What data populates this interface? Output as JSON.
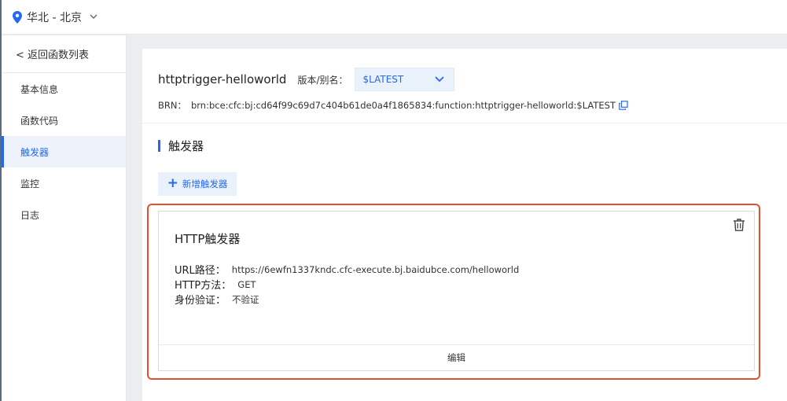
{
  "topbar": {
    "region_label": "华北 - 北京",
    "icons": {
      "pin": "location-pin-icon",
      "dropdown": "chevron-down-icon"
    }
  },
  "sidebar": {
    "back_label": "< 返回函数列表",
    "items": [
      {
        "label": "基本信息",
        "active": false
      },
      {
        "label": "函数代码",
        "active": false
      },
      {
        "label": "触发器",
        "active": true
      },
      {
        "label": "监控",
        "active": false
      },
      {
        "label": "日志",
        "active": false
      }
    ]
  },
  "main": {
    "function_name": "httptrigger-helloworld",
    "version_label": "版本/别名：",
    "version_value": "$LATEST",
    "brn_label": "BRN：",
    "brn_value": "brn:bce:cfc:bj:cd64f99c69d7c404b61de0a4f1865834:function:httptrigger-helloworld:$LATEST",
    "section_title": "触发器",
    "add_trigger_label": "新增触发器",
    "trigger": {
      "title": "HTTP触发器",
      "fields": [
        {
          "key": "URL路径：",
          "value": "https://6ewfn1337kndc.cfc-execute.bj.baidubce.com/helloworld"
        },
        {
          "key": "HTTP方法：",
          "value": "GET"
        },
        {
          "key": "身份验证：",
          "value": "不验证"
        }
      ],
      "edit_label": "编辑"
    }
  },
  "colors": {
    "accent": "#2468f2",
    "highlight": "#e2512e",
    "background": "#ebedf0"
  }
}
